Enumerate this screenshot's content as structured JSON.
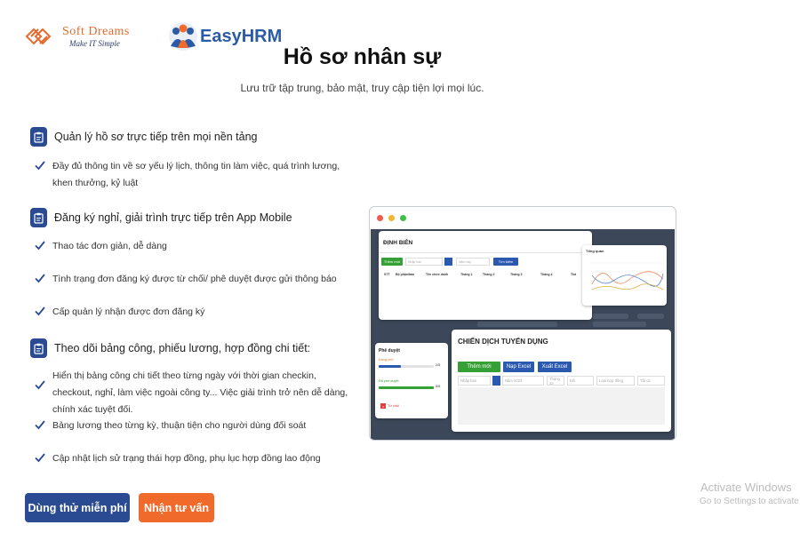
{
  "header": {
    "softdreams_name": "Soft Dreams",
    "softdreams_tagline": "Make IT Simple",
    "easyhrm_name": "EasyHRM"
  },
  "hero": {
    "title": "Hồ sơ nhân sự",
    "subtitle": "Lưu trữ tập trung, bảo mật, truy cập tiện lợi mọi lúc."
  },
  "features": [
    {
      "title": "Quản lý hồ sơ trực tiếp trên mọi nền tảng",
      "items": [
        "Đầy đủ thông tin về sơ yếu lý lịch, thông tin làm việc, quá trình lương, khen thưởng, kỷ luật"
      ]
    },
    {
      "title": "Đăng ký nghỉ, giải trình trực tiếp trên App Mobile",
      "items": [
        "Thao tác đơn giản, dễ dàng",
        "Tình trạng đơn đăng ký được từ chối/ phê duyệt được gửi thông báo",
        "Cấp quản lý nhận được đơn đăng ký"
      ]
    },
    {
      "title": "Theo dõi bảng công, phiếu lương, hợp đồng chi tiết:",
      "items": [
        "Hiển thị bảng công chi tiết theo từng ngày với thời gian checkin, checkout, nghỉ, làm việc ngoài công ty... Việc giải trình trở nên dễ dàng, chính xác tuyệt đối.",
        "Bảng lương theo từng kỳ, thuận tiện cho người dùng đối soát",
        "Cập nhật lịch sử trạng thái hợp đồng, phụ lục hợp đồng lao động"
      ]
    }
  ],
  "buttons": {
    "trial": "Dùng thử miễn phí",
    "consult": "Nhận tư vấn"
  },
  "watermark": {
    "title": "Activate Windows",
    "subtitle": "Go to Settings to activate Windows."
  },
  "mockup": {
    "dinh_bien": {
      "title": "ĐỊNH BIÊN",
      "add_label": "Thêm mới",
      "input1": "Nhập ban",
      "input2": "Năm nay",
      "search_label": "Tìm kiếm",
      "columns": [
        "STT",
        "Bộ phận/ban",
        "Tên chức danh",
        "Tháng 1",
        "Tháng 2",
        "Tháng 3",
        "Tháng 4",
        "Thá"
      ]
    },
    "chart": {
      "title": "Tổng quan"
    },
    "phe_duyet": {
      "title": "Phê duyệt",
      "row1_label": "Đang chờ",
      "row1_count": "2/5",
      "row1_fraction": 0.4,
      "row2_label": "Đã phê duyệt",
      "row2_count": "5/5",
      "row2_fraction": 1.0,
      "reject_label": "Từ chối"
    },
    "chien_dich": {
      "title": "CHIẾN DỊCH TUYỂN DỤNG",
      "add_label": "Thêm mới",
      "import_label": "Nạp Excel",
      "export_label": "Xuất Excel",
      "inputs": [
        "Nhập ban",
        "Năm 2023",
        "Tháng 12",
        "Đối",
        "Loại hợp đồng",
        "Tất cả"
      ]
    }
  },
  "colors": {
    "primary": "#2a4b92",
    "accent": "#ef6a2b",
    "green": "#35a035",
    "brand_orange": "#e56a2c"
  }
}
